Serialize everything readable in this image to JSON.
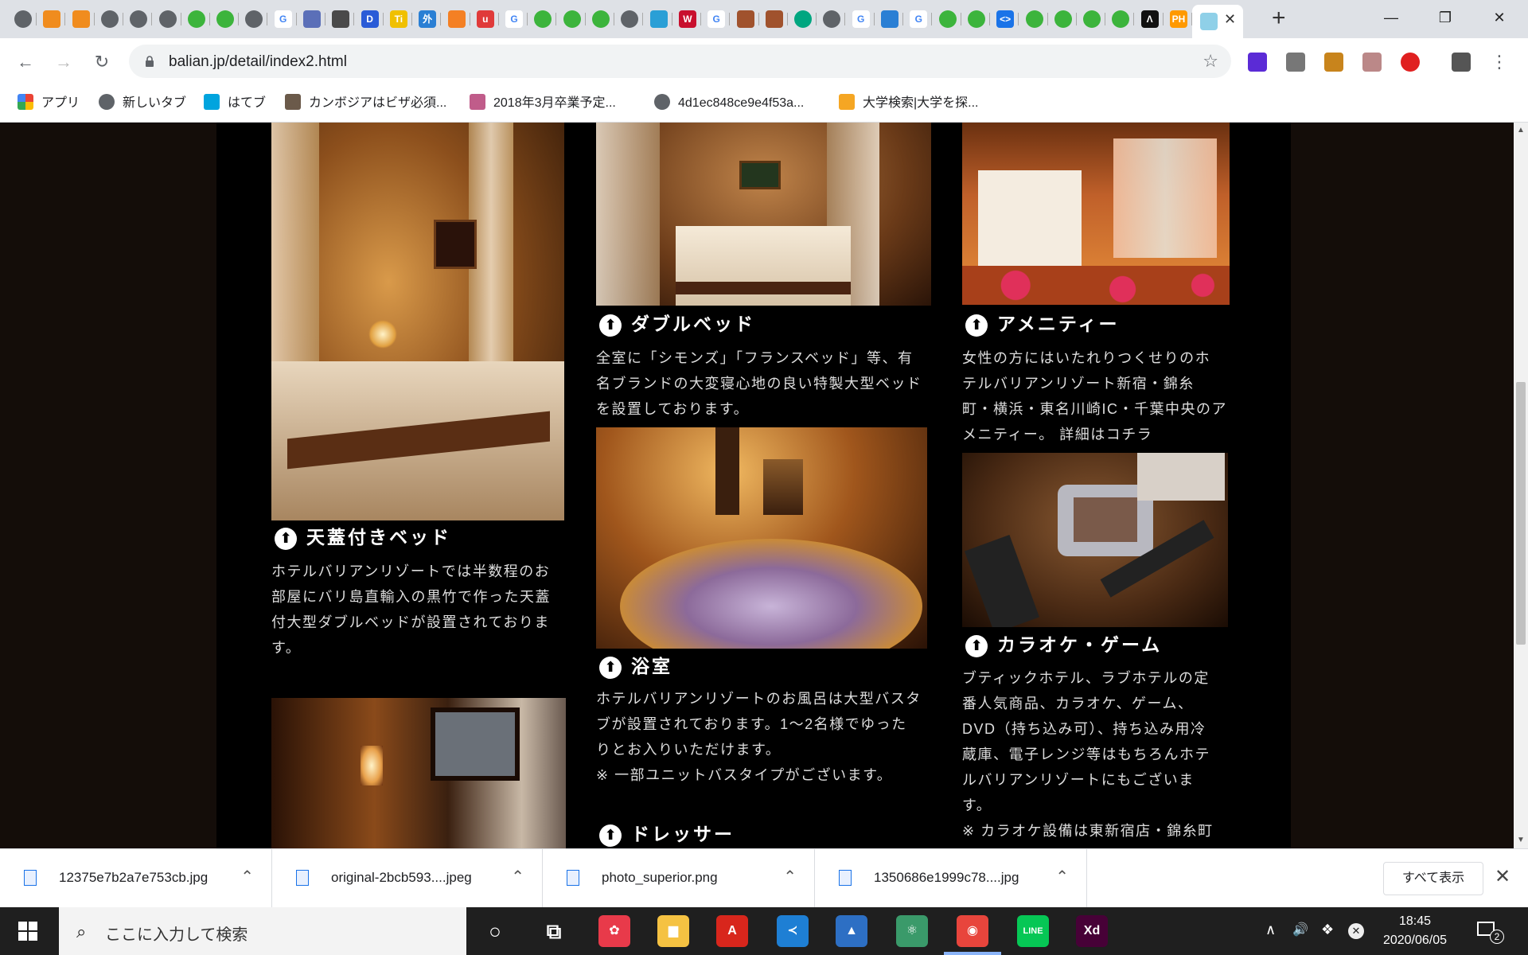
{
  "browser": {
    "tabs": {
      "active_close_label": "✕",
      "new_tab_label": "+",
      "icons": [
        {
          "name": "globe-icon",
          "text": "",
          "color": "#5f6368"
        },
        {
          "name": "box-icon",
          "text": "",
          "color": "#f08c1e"
        },
        {
          "name": "box-icon",
          "text": "",
          "color": "#f08c1e"
        },
        {
          "name": "globe-icon",
          "text": "",
          "color": "#5f6368"
        },
        {
          "name": "globe-icon",
          "text": "",
          "color": "#5f6368"
        },
        {
          "name": "globe-icon",
          "text": "",
          "color": "#5f6368"
        },
        {
          "name": "green-q-icon",
          "text": "",
          "color": "#3cb43c"
        },
        {
          "name": "green-q-icon",
          "text": "",
          "color": "#3cb43c"
        },
        {
          "name": "globe-icon",
          "text": "",
          "color": "#5f6368"
        },
        {
          "name": "google-icon",
          "text": "G",
          "color": "#4285f4"
        },
        {
          "name": "grid-icon",
          "text": "",
          "color": "#5b6fb8"
        },
        {
          "name": "folder-icon",
          "text": "",
          "color": "#4a4a4a"
        },
        {
          "name": "d-icon",
          "text": "D",
          "color": "#2a5bd7"
        },
        {
          "name": "ti-icon",
          "text": "Ti",
          "color": "#f0c000"
        },
        {
          "name": "gai-icon",
          "text": "外",
          "color": "#2a7fd4"
        },
        {
          "name": "stack-icon",
          "text": "",
          "color": "#f48024"
        },
        {
          "name": "u-icon",
          "text": "u",
          "color": "#e03a3a"
        },
        {
          "name": "google-icon",
          "text": "G",
          "color": "#4285f4"
        },
        {
          "name": "green-q-icon",
          "text": "",
          "color": "#3cb43c"
        },
        {
          "name": "green-q-icon",
          "text": "",
          "color": "#3cb43c"
        },
        {
          "name": "green-q-icon",
          "text": "",
          "color": "#3cb43c"
        },
        {
          "name": "globe-icon",
          "text": "",
          "color": "#5f6368"
        },
        {
          "name": "wave-icon",
          "text": "",
          "color": "#2a9fd6"
        },
        {
          "name": "w-icon",
          "text": "W",
          "color": "#c8102e"
        },
        {
          "name": "google-icon",
          "text": "G",
          "color": "#4285f4"
        },
        {
          "name": "wood-icon",
          "text": "",
          "color": "#a0522d"
        },
        {
          "name": "wood-icon",
          "text": "",
          "color": "#a0522d"
        },
        {
          "name": "tripadvisor-icon",
          "text": "",
          "color": "#00a680"
        },
        {
          "name": "globe-icon",
          "text": "",
          "color": "#5f6368"
        },
        {
          "name": "google-icon",
          "text": "G",
          "color": "#4285f4"
        },
        {
          "name": "chevrons-up-icon",
          "text": "",
          "color": "#2a7fd4"
        },
        {
          "name": "google-icon",
          "text": "G",
          "color": "#4285f4"
        },
        {
          "name": "green-q-icon",
          "text": "",
          "color": "#3cb43c"
        },
        {
          "name": "green-q-icon",
          "text": "",
          "color": "#3cb43c"
        },
        {
          "name": "code-icon",
          "text": "<>",
          "color": "#1a73e8"
        },
        {
          "name": "green-q-icon",
          "text": "",
          "color": "#3cb43c"
        },
        {
          "name": "green-q-icon",
          "text": "",
          "color": "#3cb43c"
        },
        {
          "name": "green-q-icon",
          "text": "",
          "color": "#3cb43c"
        },
        {
          "name": "green-q-icon",
          "text": "",
          "color": "#3cb43c"
        },
        {
          "name": "a-icon",
          "text": "Λ",
          "color": "#111111"
        },
        {
          "name": "ph-icon",
          "text": "PH",
          "color": "#ff9900"
        },
        {
          "name": "water-icon",
          "text": "",
          "color": "#5ab0d6"
        }
      ]
    },
    "toolbar": {
      "back": "←",
      "forward": "→",
      "reload": "↻",
      "url": "balian.jp/detail/index2.html",
      "star": "☆",
      "menu": "⋮"
    },
    "bookmarks": [
      {
        "label": "アプリ",
        "icon": "apps-grid-icon",
        "color": "#ea4335"
      },
      {
        "label": "新しいタブ",
        "icon": "globe-icon",
        "color": "#5f6368"
      },
      {
        "label": "はてブ",
        "icon": "hatena-icon",
        "color": "#00a4de"
      },
      {
        "label": "カンボジアはビザ必須...",
        "icon": "photo-icon",
        "color": "#6b5a4a"
      },
      {
        "label": "2018年3月卒業予定...",
        "icon": "site-icon",
        "color": "#c05c8a"
      },
      {
        "label": "4d1ec848ce9e4f53a...",
        "icon": "globe-icon",
        "color": "#5f6368"
      },
      {
        "label": "大学検索|大学を探...",
        "icon": "k-icon",
        "color": "#f5a623"
      }
    ]
  },
  "content": {
    "sections": [
      {
        "id": "canopy",
        "title": "天蓋付きベッド",
        "lines": [
          "ホテルバリアンリゾートでは半数程のお",
          "部屋にバリ島直輸入の黒竹で作った天蓋",
          "付大型ダブルベッドが設置されておりま",
          "す。"
        ]
      },
      {
        "id": "double",
        "title": "ダブルベッド",
        "lines": [
          "全室に「シモンズ」「フランスベッド」等、有",
          "名ブランドの大変寝心地の良い特製大型ベッド",
          "を設置しております。"
        ]
      },
      {
        "id": "amenity",
        "title": "アメニティー",
        "lines": [
          "女性の方にはいたれりつくせりのホ",
          "テルバリアンリゾート新宿・錦糸",
          "町・横浜・東名川崎IC・千葉中央のア",
          "メニティー。 詳細はコチラ"
        ]
      },
      {
        "id": "bath",
        "title": "浴室",
        "lines": [
          "ホテルバリアンリゾートのお風呂は大型バスタ",
          "ブが設置されております。1～2名様でゆった",
          "りとお入りいただけます。",
          "※ 一部ユニットバスタイプがございます。"
        ]
      },
      {
        "id": "karaoke",
        "title": "カラオケ・ゲーム",
        "lines": [
          "ブティックホテル、ラブホテルの定",
          "番人気商品、カラオケ、ゲーム、",
          "DVD（持ち込み可）、持ち込み用冷",
          "蔵庫、電子レンジ等はもちろんホテ",
          "ルバリアンリゾートにもございま",
          "す。",
          "※ カラオケ設備は東新宿店・錦糸町"
        ]
      },
      {
        "id": "dresser",
        "title": "ドレッサー",
        "lines": []
      }
    ]
  },
  "downloads": {
    "items": [
      {
        "name": "12375e7b2a7e753cb.jpg"
      },
      {
        "name": "original-2bcb593....jpeg"
      },
      {
        "name": "photo_superior.png"
      },
      {
        "name": "1350686e1999c78....jpg"
      }
    ],
    "show_all": "すべて表示",
    "close": "✕"
  },
  "taskbar": {
    "search_placeholder": "ここに入力して検索",
    "apps": [
      {
        "name": "cortana-icon",
        "text": "○",
        "color": "transparent"
      },
      {
        "name": "task-view-icon",
        "text": "⧉",
        "color": "transparent"
      },
      {
        "name": "app-flower-icon",
        "text": "✿",
        "color": "#e83a4a"
      },
      {
        "name": "file-explorer-icon",
        "text": "▆",
        "color": "#f5c242"
      },
      {
        "name": "acrobat-icon",
        "text": "A",
        "color": "#d8261c"
      },
      {
        "name": "vscode-icon",
        "text": "≺",
        "color": "#1e7fd4"
      },
      {
        "name": "photos-icon",
        "text": "▲",
        "color": "#2d6fc4"
      },
      {
        "name": "atom-icon",
        "text": "⚛",
        "color": "#3a9a6a"
      },
      {
        "name": "chrome-icon",
        "text": "◉",
        "color": "#e8453c"
      },
      {
        "name": "line-icon",
        "text": "LINE",
        "color": "#06c755"
      },
      {
        "name": "xd-icon",
        "text": "Xd",
        "color": "#470137"
      }
    ],
    "tray": {
      "chevron": "∧",
      "volume": "🔊",
      "dropbox": "❖",
      "time": "18:45",
      "date": "2020/06/05",
      "notifications": "2"
    }
  }
}
